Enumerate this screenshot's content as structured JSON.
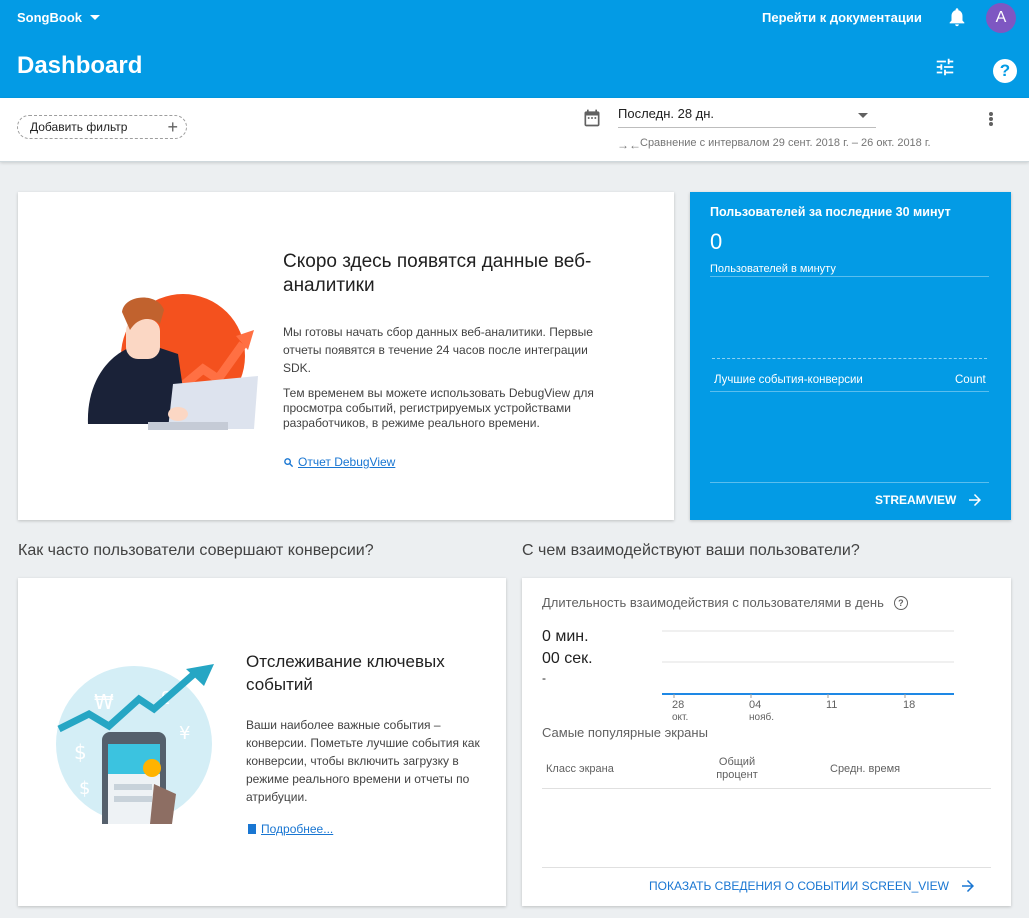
{
  "header": {
    "project_name": "SongBook",
    "docs_link": "Перейти к документации",
    "avatar_initial": "A",
    "page_title": "Dashboard"
  },
  "filters": {
    "add_filter_label": "Добавить фильтр",
    "date_range": "Последн. 28 дн.",
    "compare_text": "Сравнение с интервалом 29 сент. 2018 г. – 26 окт. 2018 г."
  },
  "web_card": {
    "title": "Скоро здесь появятся данные веб-аналитики",
    "paragraph1": "Мы готовы начать сбор данных веб-аналитики. Первые отчеты появятся в течение 24 часов после интеграции SDK.",
    "paragraph2": "Тем временем вы можете использовать DebugView для просмотра событий, регистрируемых устройствами разработчиков, в режиме реального времени.",
    "debug_link": "Отчет DebugView"
  },
  "realtime": {
    "title": "Пользователей за последние 30 минут",
    "value": "0",
    "per_minute_label": "Пользователей в минуту",
    "events_label": "Лучшие события-конверсии",
    "count_label": "Count",
    "streamview_label": "STREAMVIEW"
  },
  "sections": {
    "conversions_heading": "Как часто пользователи совершают конверсии?",
    "engagement_heading": "С чем взаимодействуют ваши пользователи?"
  },
  "conversions_card": {
    "title": "Отслеживание ключевых событий",
    "text": "Ваши наиболее важные события – конверсии. Пометьте лучшие события как конверсии, чтобы включить загрузку в режиме реального времени и отчеты по атрибуции.",
    "more_link": "Подробнее..."
  },
  "engagement_card": {
    "title": "Длительность взаимодействия с пользователями в день",
    "minutes": "0 мин.",
    "seconds": "00 сек.",
    "change": "-",
    "screens_title": "Самые популярные экраны",
    "columns": [
      "Класс экрана",
      "Общий процент",
      "Средн. время"
    ],
    "screen_view_link": "ПОКАЗАТЬ СВЕДЕНИЯ О СОБЫТИИ SCREEN_VIEW"
  },
  "chart_data": {
    "type": "line",
    "title": "Длительность взаимодействия с пользователями в день",
    "x_ticks": [
      {
        "day": "28",
        "month": "окт."
      },
      {
        "day": "04",
        "month": "нояб."
      },
      {
        "day": "11",
        "month": ""
      },
      {
        "day": "18",
        "month": ""
      }
    ],
    "series": [
      {
        "values": [
          0,
          0,
          0,
          0,
          0,
          0,
          0,
          0,
          0,
          0,
          0,
          0,
          0,
          0,
          0,
          0,
          0,
          0,
          0,
          0,
          0,
          0,
          0,
          0,
          0,
          0,
          0,
          0
        ]
      }
    ],
    "grid": true
  },
  "colors": {
    "appbar": "#039be5",
    "accent_orange": "#f4511e",
    "link": "#1976d2"
  }
}
